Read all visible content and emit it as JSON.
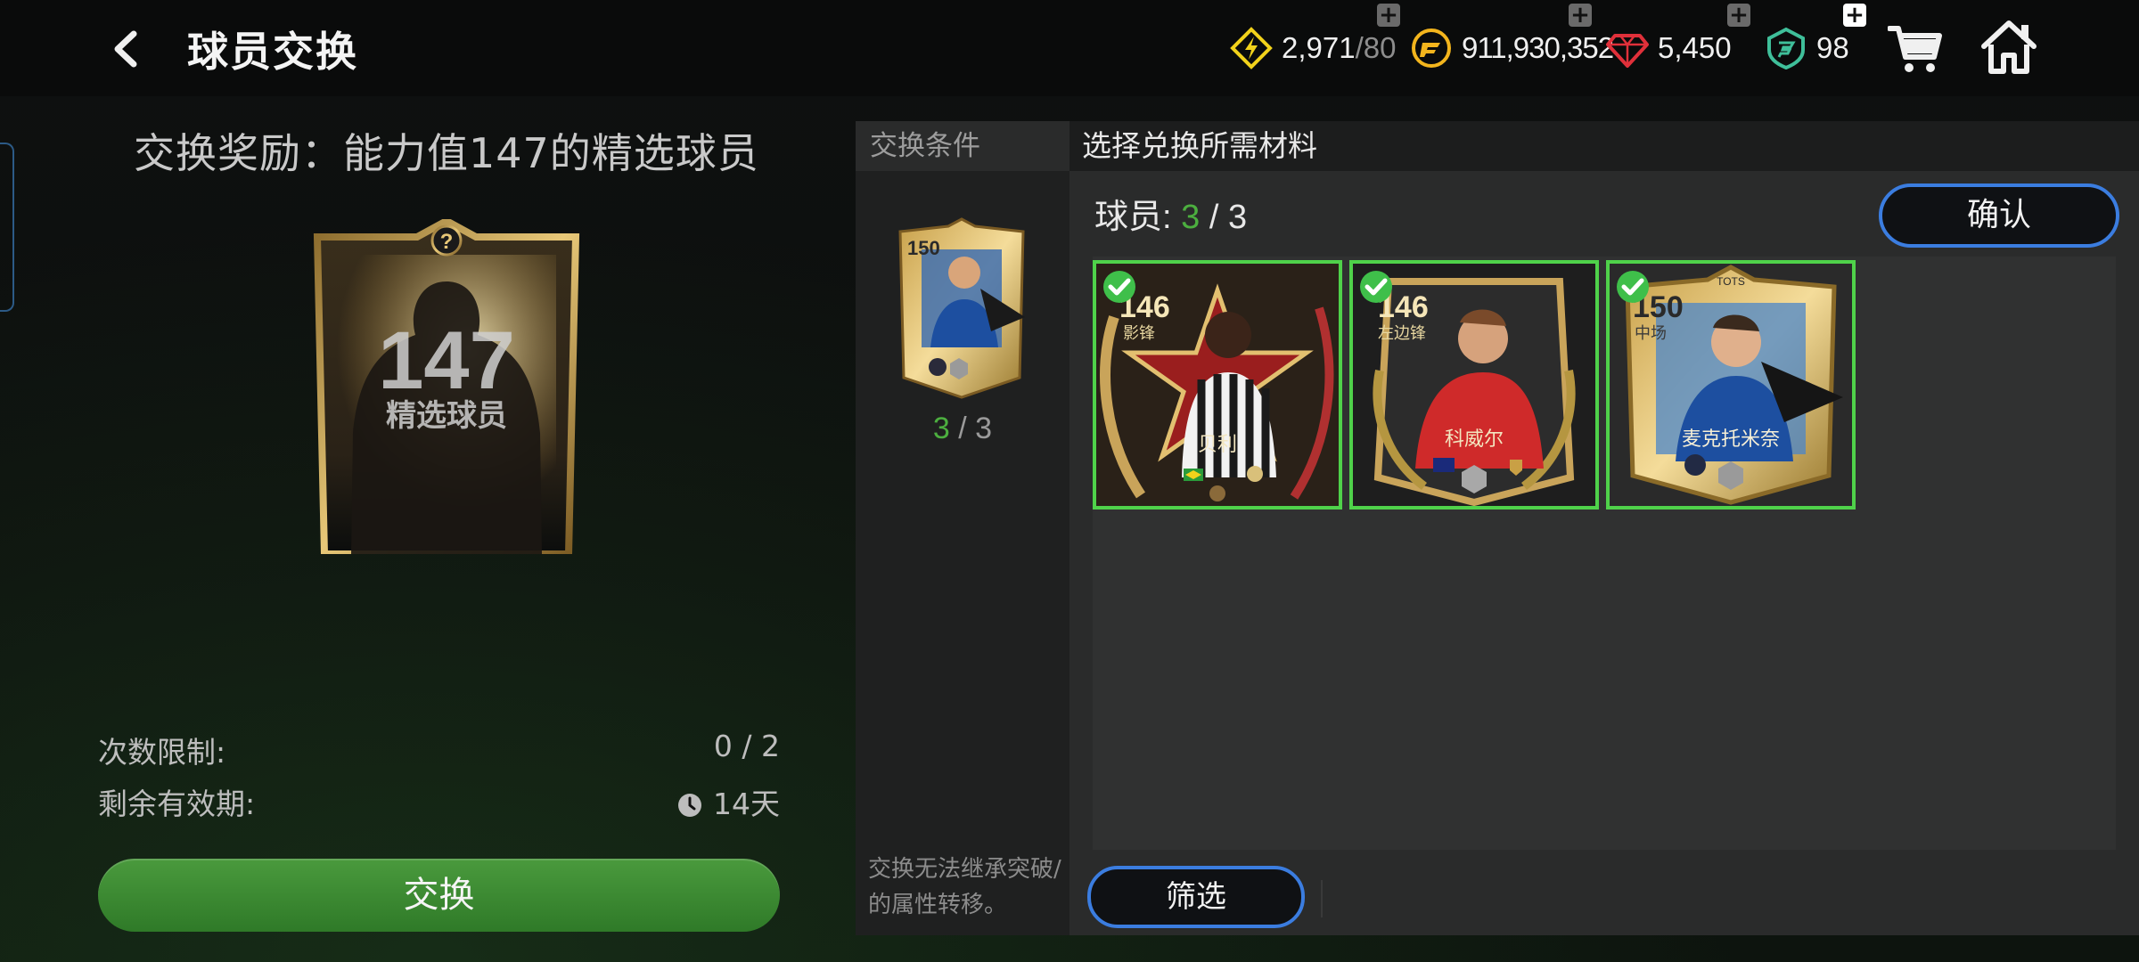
{
  "header": {
    "title": "球员交换",
    "currencies": [
      {
        "icon": "lightning-icon",
        "value": "2,971",
        "suffix": "/80",
        "color": "#f2d21b"
      },
      {
        "icon": "fc-points-coin-icon",
        "value": "911,930,352",
        "suffix": "",
        "color": "#f3b51d"
      },
      {
        "icon": "red-gem-icon",
        "value": "5,450",
        "suffix": "",
        "color": "#e0303a"
      },
      {
        "icon": "green-shield-icon",
        "value": "98",
        "suffix": "",
        "color": "#3fbf9a"
      }
    ],
    "plus_label": "+"
  },
  "reward": {
    "title": "交换奖励：能力值147的精选球员",
    "card_rating": "147",
    "card_label": "精选球员",
    "card_question": "?",
    "limit_label": "次数限制:",
    "limit_value": "0 / 2",
    "validity_label": "剩余有效期:",
    "validity_value": "14天",
    "exchange_button": "交换"
  },
  "conditions": {
    "header": "交换条件",
    "card_rating": "150",
    "count_have": "3",
    "count_sep": " / ",
    "count_total": "3",
    "note": "交换无法继承突破/的属性转移。"
  },
  "materials": {
    "header": "选择兑换所需材料",
    "players_label": "球员: ",
    "players_have": "3",
    "players_sep": " / ",
    "players_total": "3",
    "confirm_button": "确认",
    "filter_button": "筛选",
    "cards": [
      {
        "rating": "146",
        "position": "影锋",
        "name": "贝利",
        "theme": "dragon",
        "flag": "brazil"
      },
      {
        "rating": "146",
        "position": "左边锋",
        "name": "科威尔",
        "theme": "laurel",
        "flag": "australia"
      },
      {
        "rating": "150",
        "position": "中场",
        "name": "麦克托米奈",
        "theme": "tots",
        "tag": "TOTS",
        "flag": "scotland"
      }
    ]
  },
  "colors": {
    "accent_blue": "#3b7de0",
    "selected_green": "#4fd24a",
    "progress_green": "#4caf3f",
    "exchange_green": "#3f8c34"
  }
}
